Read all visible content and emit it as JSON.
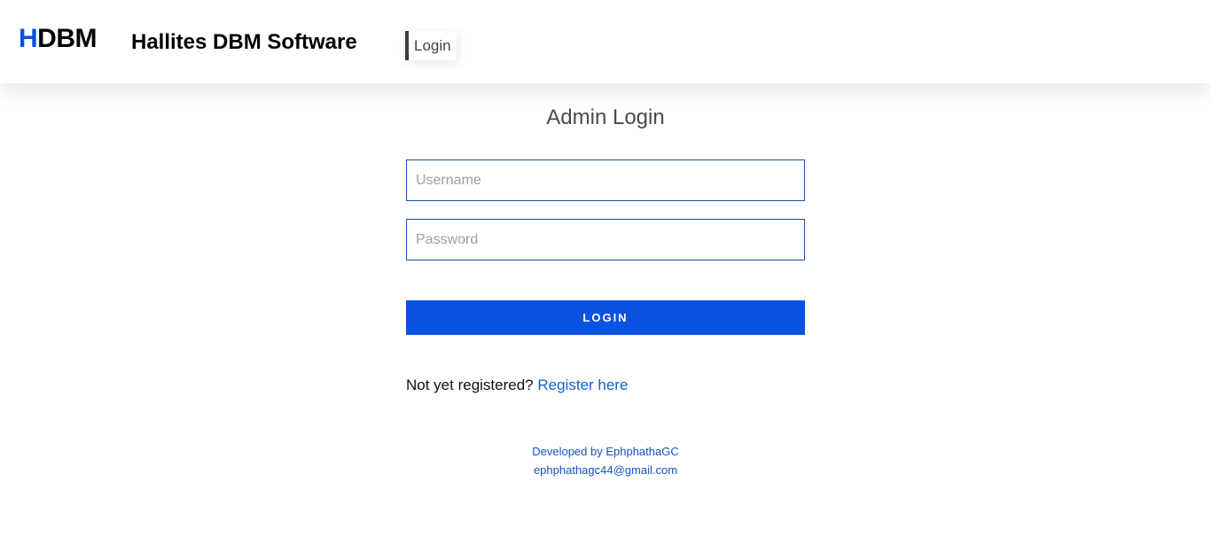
{
  "header": {
    "logo_h": "H",
    "logo_rest": "DBM",
    "app_title": "Hallites DBM Software",
    "nav_login": "Login"
  },
  "main": {
    "title": "Admin Login",
    "username_placeholder": "Username",
    "password_placeholder": "Password",
    "login_button": "LOGIN",
    "register_prompt": "Not yet registered?",
    "register_link": "Register here"
  },
  "footer": {
    "developer": "Developed by EphphathaGC",
    "email": "ephphathagc44@gmail.com"
  },
  "colors": {
    "accent": "#0a52e0",
    "link": "#1363c9",
    "input_border": "#1d4fa8"
  }
}
